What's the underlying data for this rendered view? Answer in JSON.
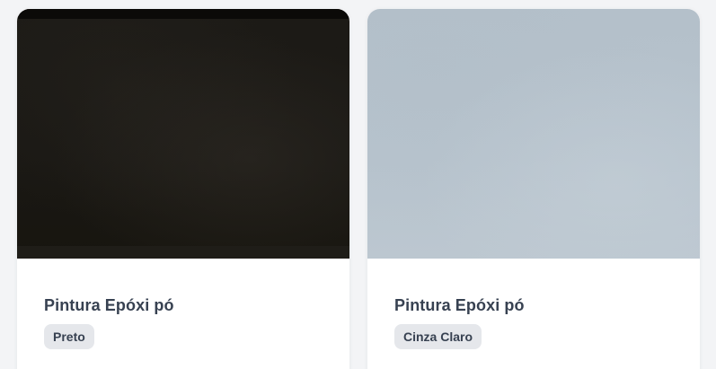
{
  "products": [
    {
      "title": "Pintura Epóxi pó",
      "color_label": "Preto",
      "swatch_color": "#1c1a16"
    },
    {
      "title": "Pintura Epóxi pó",
      "color_label": "Cinza Claro",
      "swatch_color": "#b5c1cb"
    }
  ]
}
